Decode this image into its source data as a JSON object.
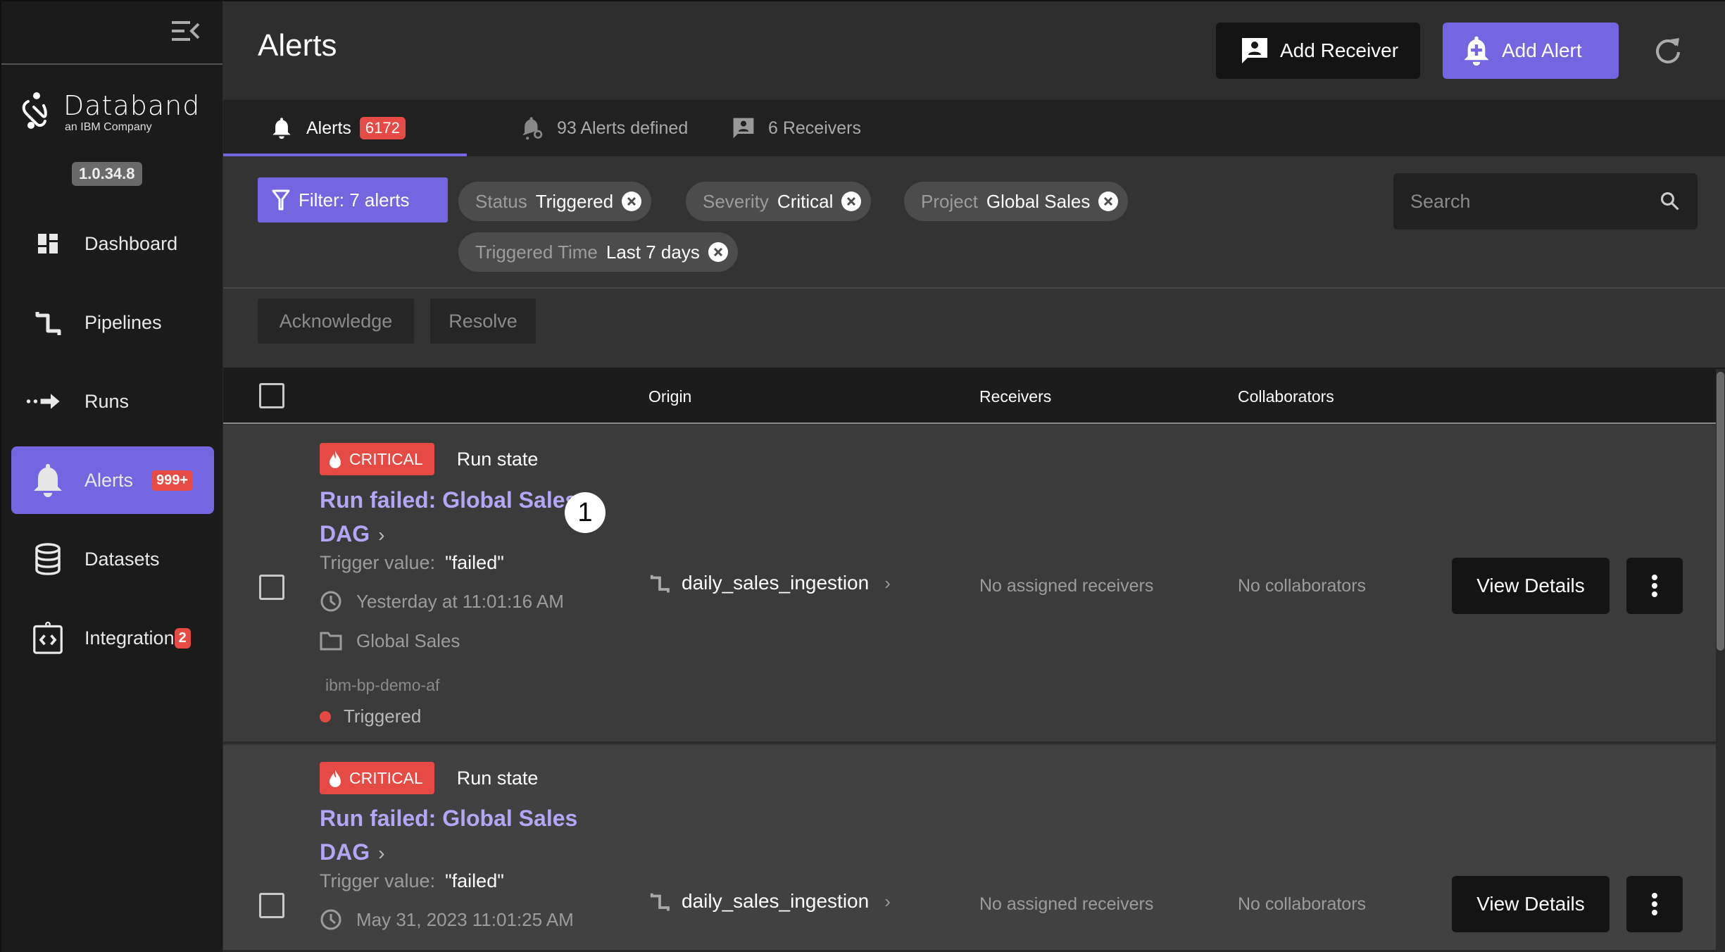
{
  "sidebar": {
    "brand": {
      "name": "Databand",
      "subtitle": "an IBM Company"
    },
    "version": "1.0.34.8",
    "items": [
      {
        "label": "Dashboard",
        "icon": "dashboard-icon",
        "badge": null,
        "active": false
      },
      {
        "label": "Pipelines",
        "icon": "pipelines-icon",
        "badge": null,
        "active": false
      },
      {
        "label": "Runs",
        "icon": "runs-icon",
        "badge": null,
        "active": false
      },
      {
        "label": "Alerts",
        "icon": "bell-icon",
        "badge": "999+",
        "active": true
      },
      {
        "label": "Datasets",
        "icon": "database-icon",
        "badge": null,
        "active": false
      },
      {
        "label": "Integration",
        "icon": "integration-icon",
        "badge": "2",
        "active": false
      }
    ]
  },
  "header": {
    "title": "Alerts",
    "add_receiver_label": "Add Receiver",
    "add_alert_label": "Add Alert"
  },
  "tabs": [
    {
      "label": "Alerts",
      "badge": "6172",
      "icon": "bell-icon",
      "active": true
    },
    {
      "label": "93 Alerts defined",
      "icon": "bell-settings-icon",
      "active": false
    },
    {
      "label": "6 Receivers",
      "icon": "receiver-icon",
      "active": false
    }
  ],
  "filters": {
    "button_label": "Filter: 7 alerts",
    "chips": [
      {
        "key": "Status",
        "value": "Triggered"
      },
      {
        "key": "Severity",
        "value": "Critical"
      },
      {
        "key": "Project",
        "value": "Global Sales"
      },
      {
        "key": "Triggered Time",
        "value": "Last 7 days"
      }
    ],
    "search_placeholder": "Search"
  },
  "actions": {
    "acknowledge_label": "Acknowledge",
    "resolve_label": "Resolve"
  },
  "table": {
    "columns": [
      "Origin",
      "Receivers",
      "Collaborators"
    ],
    "rows": [
      {
        "severity": "CRITICAL",
        "type": "Run state",
        "title": "Run failed: Global Sales DAG",
        "trigger_label": "Trigger value:",
        "trigger_value": "\"failed\"",
        "time": "Yesterday at 11:01:16 AM",
        "project": "Global Sales",
        "source": "ibm-bp-demo-af",
        "status": "Triggered",
        "origin": "daily_sales_ingestion",
        "receivers": "No assigned receivers",
        "collaborators": "No collaborators",
        "view_label": "View Details",
        "marker": "1"
      },
      {
        "severity": "CRITICAL",
        "type": "Run state",
        "title": "Run failed: Global Sales DAG",
        "trigger_label": "Trigger value:",
        "trigger_value": "\"failed\"",
        "time": "May 31, 2023 11:01:25 AM",
        "origin": "daily_sales_ingestion",
        "receivers": "No assigned receivers",
        "collaborators": "No collaborators",
        "view_label": "View Details"
      }
    ]
  },
  "colors": {
    "accent": "#7366e0",
    "critical": "#e54b44",
    "link": "#b3a6f5"
  }
}
